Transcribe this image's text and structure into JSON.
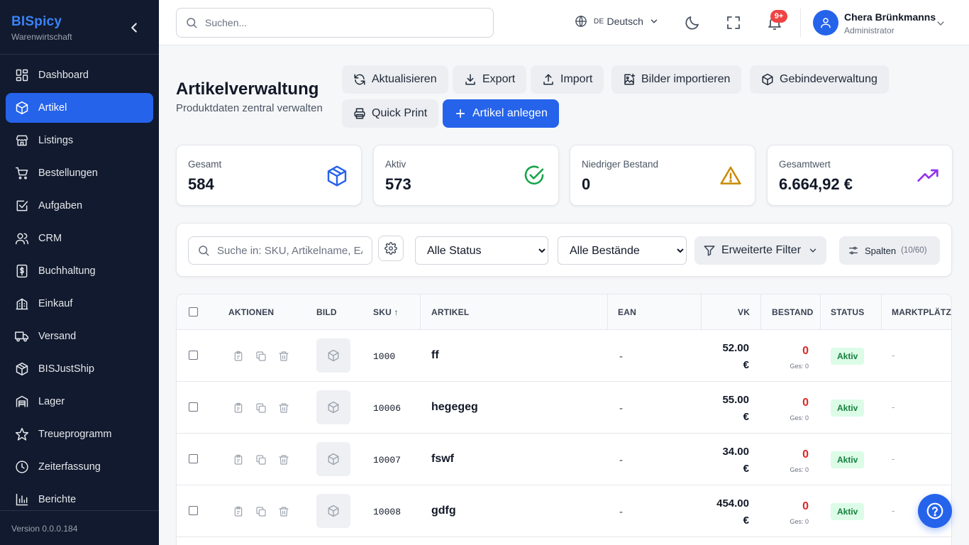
{
  "app": {
    "name": "BISpicy",
    "subtitle": "Warenwirtschaft",
    "version": "Version 0.0.0.184"
  },
  "sidebar": {
    "items": [
      {
        "label": "Dashboard",
        "icon": "dashboard-icon",
        "active": false
      },
      {
        "label": "Artikel",
        "icon": "cube-icon",
        "active": true
      },
      {
        "label": "Listings",
        "icon": "store-icon",
        "active": false
      },
      {
        "label": "Bestellungen",
        "icon": "cart-icon",
        "active": false
      },
      {
        "label": "Aufgaben",
        "icon": "checkbox-icon",
        "active": false
      },
      {
        "label": "CRM",
        "icon": "users-icon",
        "active": false
      },
      {
        "label": "Buchhaltung",
        "icon": "dollar-doc-icon",
        "active": false
      },
      {
        "label": "Einkauf",
        "icon": "building-icon",
        "active": false
      },
      {
        "label": "Versand",
        "icon": "truck-icon",
        "active": false
      },
      {
        "label": "BISJustShip",
        "icon": "package-icon",
        "active": false
      },
      {
        "label": "Lager",
        "icon": "warehouse-icon",
        "active": false
      },
      {
        "label": "Treueprogramm",
        "icon": "star-icon",
        "active": false
      },
      {
        "label": "Zeiterfassung",
        "icon": "clock-icon",
        "active": false
      },
      {
        "label": "Berichte",
        "icon": "bar-chart-icon",
        "active": false
      }
    ]
  },
  "topbar": {
    "search_placeholder": "Suchen...",
    "language_flag": "DE",
    "language": "Deutsch",
    "notification_badge": "9+",
    "user_name": "Chera Brünkmanns",
    "user_role": "Administrator"
  },
  "page": {
    "title": "Artikelverwaltung",
    "subtitle": "Produktdaten zentral verwalten"
  },
  "toolbar": {
    "refresh": "Aktualisieren",
    "export": "Export",
    "import": "Import",
    "import_images": "Bilder importieren",
    "container_mgmt": "Gebindeverwaltung",
    "quick_print": "Quick Print",
    "create_article": "Artikel anlegen"
  },
  "stats": [
    {
      "label": "Gesamt",
      "value": "584",
      "icon": "cube-icon",
      "color": "#2563eb"
    },
    {
      "label": "Aktiv",
      "value": "573",
      "icon": "check-circle-icon",
      "color": "#16a34a"
    },
    {
      "label": "Niedriger Bestand",
      "value": "0",
      "icon": "warning-icon",
      "color": "#ca8a04"
    },
    {
      "label": "Gesamtwert",
      "value": "6.664,92 €",
      "icon": "trending-up-icon",
      "color": "#9333ea"
    }
  ],
  "filters": {
    "search_placeholder": "Suche in: SKU, Artikelname, EAN",
    "status_selected": "Alle Status",
    "stock_selected": "Alle Bestände",
    "advanced": "Erweiterte Filter",
    "columns_label": "Spalten",
    "columns_count": "(10/60)"
  },
  "table": {
    "headers": {
      "actions": "AKTIONEN",
      "image": "BILD",
      "sku": "SKU ↑",
      "article": "ARTIKEL",
      "ean": "EAN",
      "vk": "VK",
      "stock": "BESTAND",
      "status": "STATUS",
      "marketplaces": "MARKTPLÄTZE"
    },
    "rows": [
      {
        "sku": "1000",
        "name": "ff",
        "ean": "-",
        "vk": "52.00",
        "currency": "€",
        "stock": "0",
        "stock_total": "Ges: 0",
        "status": "Aktiv",
        "marketplaces": "-"
      },
      {
        "sku": "10006",
        "name": "hegegeg",
        "ean": "-",
        "vk": "55.00",
        "currency": "€",
        "stock": "0",
        "stock_total": "Ges: 0",
        "status": "Aktiv",
        "marketplaces": "-"
      },
      {
        "sku": "10007",
        "name": "fswf",
        "ean": "-",
        "vk": "34.00",
        "currency": "€",
        "stock": "0",
        "stock_total": "Ges: 0",
        "status": "Aktiv",
        "marketplaces": "-"
      },
      {
        "sku": "10008",
        "name": "gdfg",
        "ean": "-",
        "vk": "454.00",
        "currency": "€",
        "stock": "0",
        "stock_total": "Ges: 0",
        "status": "Aktiv",
        "marketplaces": "-"
      }
    ]
  }
}
